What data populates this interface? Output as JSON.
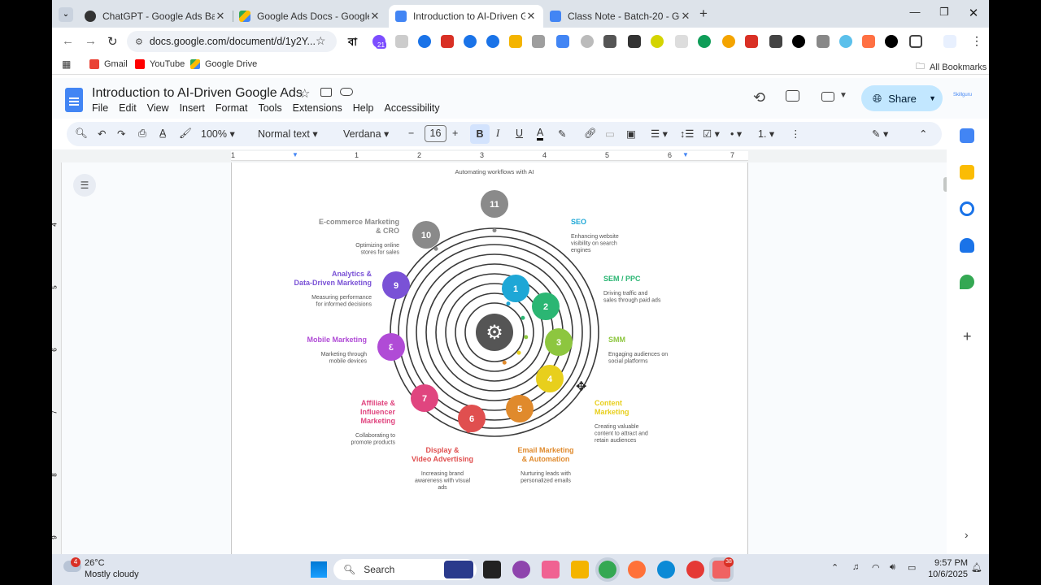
{
  "tabs": [
    {
      "title": "ChatGPT - Google Ads Batch-2(",
      "active": false
    },
    {
      "title": "Google Ads Docs - Google Driv",
      "active": false
    },
    {
      "title": "Introduction to AI-Driven Goog",
      "active": true
    },
    {
      "title": "Class Note - Batch-20 - Google",
      "active": false
    }
  ],
  "address": "docs.google.com/document/d/1y2Y...",
  "bookmarks": [
    "Gmail",
    "YouTube",
    "Google Drive"
  ],
  "all_bookmarks": "All Bookmarks",
  "ext_badge": "21",
  "doc": {
    "title": "Introduction to AI-Driven Google Ads",
    "menus": [
      "File",
      "Edit",
      "View",
      "Insert",
      "Format",
      "Tools",
      "Extensions",
      "Help",
      "Accessibility"
    ],
    "share": "Share"
  },
  "format": {
    "zoom": "100%",
    "style": "Normal text",
    "font": "Verdana",
    "size": "16"
  },
  "ruler_marks": [
    "1",
    "1",
    "2",
    "3",
    "4",
    "5",
    "6",
    "7"
  ],
  "left_ruler_marks": [
    "4",
    "5",
    "6",
    "7",
    "8",
    "9"
  ],
  "diagram": {
    "top_caption": "Automating workflows with AI",
    "items": [
      {
        "n": "1",
        "title": "SEO",
        "desc": "Enhancing website visibility on search engines",
        "color": "#1ea7d6"
      },
      {
        "n": "2",
        "title": "SEM / PPC",
        "desc": "Driving traffic and sales through paid ads",
        "color": "#2bb673"
      },
      {
        "n": "3",
        "title": "SMM",
        "desc": "Engaging audiences on social platforms",
        "color": "#8dc63f"
      },
      {
        "n": "4",
        "title": "Content Marketing",
        "desc": "Creating valuable content to attract and retain audiences",
        "color": "#e8cf1c"
      },
      {
        "n": "5",
        "title": "Email Marketing & Automation",
        "desc": "Nurturing leads with personalized emails",
        "color": "#e08a2c"
      },
      {
        "n": "6",
        "title": "Display & Video Advertising",
        "desc": "Increasing brand awareness with visual ads",
        "color": "#e04f4f"
      },
      {
        "n": "7",
        "title": "Affiliate & Influencer Marketing",
        "desc": "Collaborating to promote products",
        "color": "#e0457f"
      },
      {
        "n": "8",
        "title": "Mobile Marketing",
        "desc": "Marketing through mobile devices",
        "color": "#b04bd6"
      },
      {
        "n": "9",
        "title": "Analytics & Data-Driven Marketing",
        "desc": "Measuring performance for informed decisions",
        "color": "#7a52d6"
      },
      {
        "n": "10",
        "title": "E-commerce Marketing & CRO",
        "desc": "Optimizing online stores for sales",
        "color": "#8a8a8a"
      },
      {
        "n": "11",
        "title": "",
        "desc": "",
        "color": "#8a8a8a"
      }
    ]
  },
  "taskbar": {
    "temp": "26°C",
    "weather": "Mostly cloudy",
    "search": "Search",
    "time": "9:57 PM",
    "date": "10/6/2025",
    "weather_badge": "4",
    "zoom_badge": "38"
  }
}
